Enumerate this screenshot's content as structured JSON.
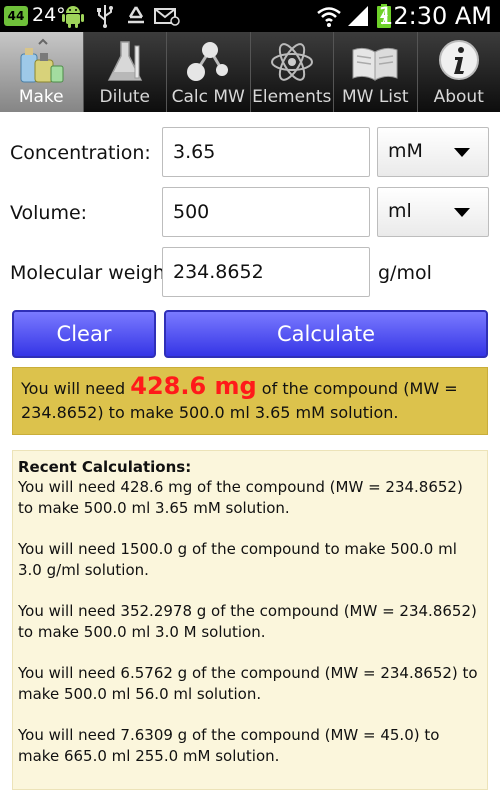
{
  "status_bar": {
    "badge": "44",
    "temperature": "24°",
    "time": "12:30 AM",
    "icons": [
      "android-icon",
      "usb-icon",
      "recycle-icon",
      "mail-icon",
      "wifi-icon",
      "signal-icon",
      "battery-charging-icon"
    ]
  },
  "tabs": [
    {
      "label": "Make",
      "icon": "flask-bottles-icon",
      "active": true
    },
    {
      "label": "Dilute",
      "icon": "beaker-icon",
      "active": false
    },
    {
      "label": "Calc MW",
      "icon": "molecule-icon",
      "active": false
    },
    {
      "label": "Elements",
      "icon": "atom-icon",
      "active": false
    },
    {
      "label": "MW List",
      "icon": "book-icon",
      "active": false
    },
    {
      "label": "About",
      "icon": "info-icon",
      "active": false
    }
  ],
  "form": {
    "concentration": {
      "label": "Concentration:",
      "value": "3.65",
      "unit": "mM"
    },
    "volume": {
      "label": "Volume:",
      "value": "500",
      "unit": "ml"
    },
    "molecular_weight": {
      "label": "Molecular weight:",
      "value": "234.8652",
      "unit": "g/mol"
    }
  },
  "buttons": {
    "clear": "Clear",
    "calculate": "Calculate"
  },
  "result": {
    "prefix": "You will need ",
    "amount": "428.6 mg",
    "suffix": " of the compound (MW = 234.8652) to make 500.0 ml 3.65 mM solution."
  },
  "recent": {
    "heading": "Recent Calculations:",
    "items": [
      "You will need 428.6 mg of the compound (MW = 234.8652) to make 500.0 ml 3.65 mM solution.",
      "You will need 1500.0 g of the compound to make 500.0 ml 3.0 g/ml solution.",
      "You will need 352.2978 g of the compound (MW = 234.8652) to make 500.0 ml 3.0 M solution.",
      "You will need 6.5762 g of the compound (MW = 234.8652) to make 500.0 ml 56.0 ml solution.",
      "You will need 7.6309 g of the compound (MW = 45.0) to make 665.0 ml 255.0 mM solution."
    ]
  },
  "colors": {
    "button": "#4a4af2",
    "result_bg": "#dcc24c",
    "result_amount": "#ff1a1a",
    "recent_bg": "#fbf6dc"
  }
}
